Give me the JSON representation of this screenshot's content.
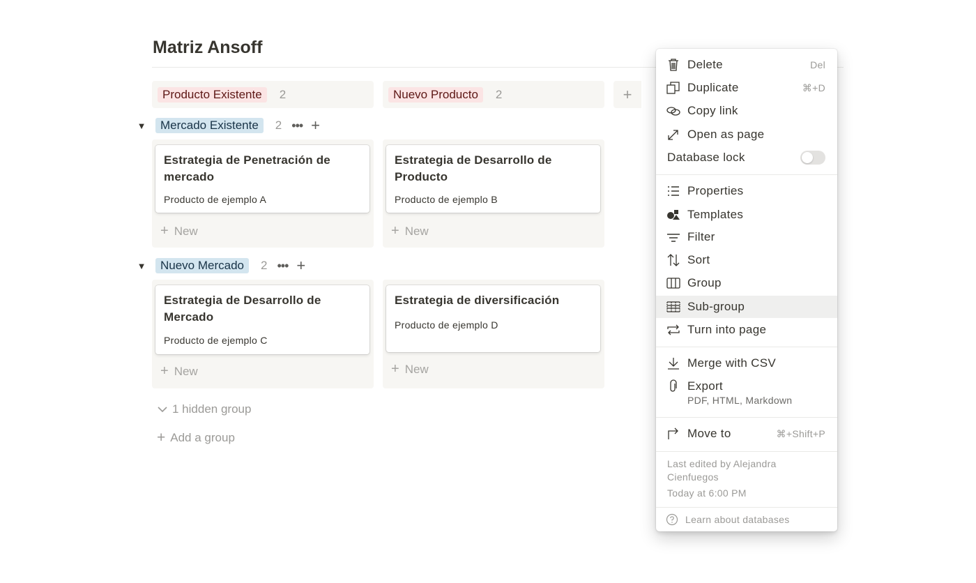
{
  "page": {
    "title": "Matriz Ansoff"
  },
  "columns": [
    {
      "label": "Producto Existente",
      "count": "2",
      "color": "#fbe4e4"
    },
    {
      "label": "Nuevo Producto",
      "count": "2",
      "color": "#fbe4e4"
    }
  ],
  "add_column_label": "+",
  "groups": [
    {
      "label": "Mercado Existente",
      "count": "2",
      "cards": [
        {
          "title": "Estrategia de Penetración de mercado",
          "prop": "Producto de ejemplo A"
        },
        {
          "title": "Estrategia de Desarrollo de Producto",
          "prop": "Producto de ejemplo B"
        }
      ]
    },
    {
      "label": "Nuevo Mercado",
      "count": "2",
      "cards": [
        {
          "title": "Estrategia de Desarrollo de Mercado",
          "prop": "Producto de ejemplo C"
        },
        {
          "title": "Estrategia de diversificación",
          "prop": "Producto de ejemplo D"
        }
      ]
    }
  ],
  "new_label": "New",
  "hidden_group_label": "1 hidden group",
  "add_group_label": "Add a group",
  "menu": {
    "items": {
      "delete": {
        "label": "Delete",
        "shortcut": "Del"
      },
      "duplicate": {
        "label": "Duplicate",
        "shortcut": "⌘+D"
      },
      "copy_link": {
        "label": "Copy link"
      },
      "open_as_page": {
        "label": "Open as page"
      },
      "database_lock": {
        "label": "Database lock",
        "on": false
      },
      "properties": {
        "label": "Properties"
      },
      "templates": {
        "label": "Templates"
      },
      "filter": {
        "label": "Filter"
      },
      "sort": {
        "label": "Sort"
      },
      "group": {
        "label": "Group"
      },
      "sub_group": {
        "label": "Sub-group"
      },
      "turn_into_page": {
        "label": "Turn into page"
      },
      "merge_csv": {
        "label": "Merge with CSV"
      },
      "export": {
        "label": "Export",
        "sub": "PDF, HTML, Markdown"
      },
      "move_to": {
        "label": "Move to",
        "shortcut": "⌘+Shift+P"
      }
    },
    "last_edited_line1": "Last edited by Alejandra",
    "last_edited_line2": "Cienfuegos",
    "edited_time": "Today at 6:00 PM",
    "learn": "Learn about databases"
  }
}
